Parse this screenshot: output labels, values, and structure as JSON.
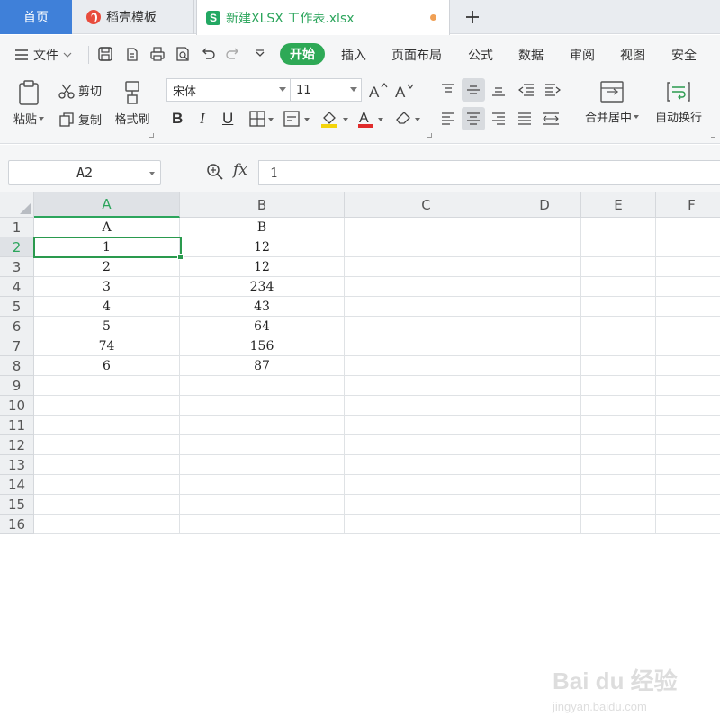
{
  "tabs": {
    "home": "首页",
    "templates": "稻壳模板",
    "document": "新建XLSX 工作表.xlsx",
    "new_tab": "+"
  },
  "menu": {
    "file": "文件",
    "items": [
      "开始",
      "插入",
      "页面布局",
      "公式",
      "数据",
      "审阅",
      "视图",
      "安全"
    ]
  },
  "ribbon": {
    "paste": "粘贴",
    "cut": "剪切",
    "copy": "复制",
    "format_painter": "格式刷",
    "font_name": "宋体",
    "font_size": "11",
    "bold": "B",
    "italic": "I",
    "underline": "U",
    "merge_center": "合并居中",
    "wrap_text": "自动换行"
  },
  "formula_bar": {
    "name_box": "A2",
    "fx": "fx",
    "value": "1"
  },
  "grid": {
    "columns": [
      "A",
      "B",
      "C",
      "D",
      "E",
      "F"
    ],
    "active_column": "A",
    "active_row": 2,
    "row_numbers": [
      "1",
      "2",
      "3",
      "4",
      "5",
      "6",
      "7",
      "8",
      "9",
      "10",
      "11",
      "12",
      "13",
      "14",
      "15",
      "16"
    ],
    "rows": [
      [
        "A",
        "B"
      ],
      [
        "1",
        "12"
      ],
      [
        "2",
        "12"
      ],
      [
        "3",
        "234"
      ],
      [
        "4",
        "43"
      ],
      [
        "5",
        "64"
      ],
      [
        "74",
        "156"
      ],
      [
        "6",
        "87"
      ]
    ]
  },
  "watermark": {
    "brand": "Bai du 经验",
    "url": "jingyan.baidu.com"
  },
  "colors": {
    "accent_green": "#2ea956",
    "home_tab_blue": "#3f80d9",
    "unsaved_dot": "#f0a055"
  }
}
